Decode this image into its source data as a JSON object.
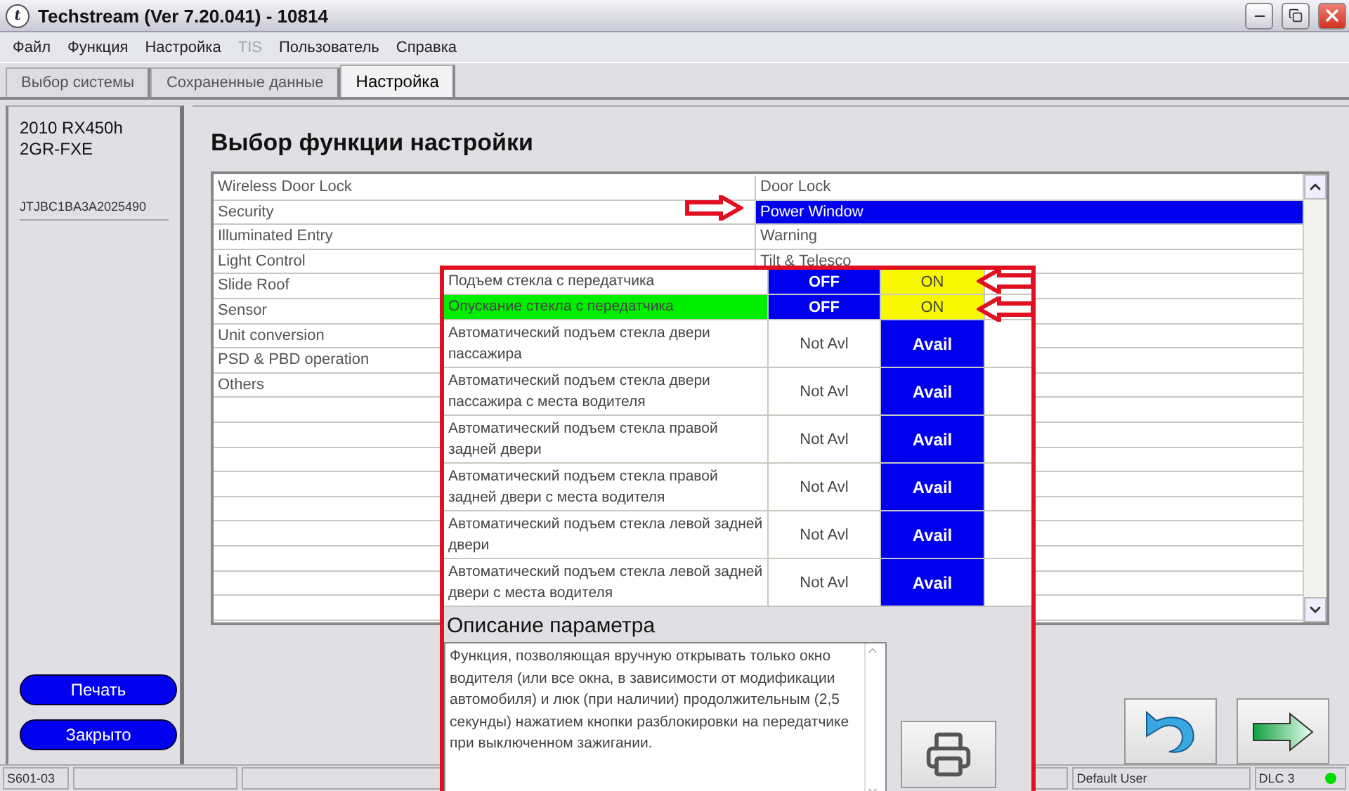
{
  "window": {
    "app_icon_letter": "t",
    "title": "Techstream (Ver 7.20.041) - 10814"
  },
  "menu": [
    {
      "label": "Файл",
      "disabled": false
    },
    {
      "label": "Функция",
      "disabled": false
    },
    {
      "label": "Настройка",
      "disabled": false
    },
    {
      "label": "TIS",
      "disabled": true
    },
    {
      "label": "Пользователь",
      "disabled": false
    },
    {
      "label": "Справка",
      "disabled": false
    }
  ],
  "tabs": [
    {
      "label": "Выбор системы",
      "selected": false
    },
    {
      "label": "Сохраненные данные",
      "selected": false
    },
    {
      "label": "Настройка",
      "selected": true
    }
  ],
  "vehicle": {
    "model": "2010 RX450h",
    "engine": "2GR-FXE",
    "vin": "JTJBC1BA3A2025490"
  },
  "sidebar_buttons": [
    "Печать",
    "Закрыто"
  ],
  "heading": "Выбор функции настройки",
  "systems": [
    "Wireless Door Lock",
    "Security",
    "Illuminated Entry",
    "Light Control",
    "Slide Roof",
    "Sensor",
    "Unit conversion",
    "PSD & PBD operation",
    "Others"
  ],
  "functions": [
    {
      "label": "Door Lock",
      "selected": false
    },
    {
      "label": "Power Window",
      "selected": true
    },
    {
      "label": "Warning",
      "selected": false
    },
    {
      "label": "Tilt & Telesco",
      "selected": false
    }
  ],
  "settings": [
    {
      "label": "Подъем стекла с передатчика",
      "highlighted": false,
      "options": [
        {
          "text": "OFF",
          "kind": "option"
        },
        {
          "text": "ON",
          "kind": "current"
        }
      ]
    },
    {
      "label": "Опускание стекла с передатчика",
      "highlighted": true,
      "options": [
        {
          "text": "OFF",
          "kind": "option"
        },
        {
          "text": "ON",
          "kind": "current"
        }
      ]
    },
    {
      "label": "Автоматический подъем стекла двери пассажира",
      "highlighted": false,
      "options": [
        {
          "text": "Not Avl",
          "kind": "plain"
        },
        {
          "text": "Avail",
          "kind": "option"
        }
      ]
    },
    {
      "label": "Автоматический подъем стекла двери пассажира с места водителя",
      "highlighted": false,
      "options": [
        {
          "text": "Not Avl",
          "kind": "plain"
        },
        {
          "text": "Avail",
          "kind": "option"
        }
      ]
    },
    {
      "label": "Автоматический подъем стекла правой задней двери",
      "highlighted": false,
      "options": [
        {
          "text": "Not Avl",
          "kind": "plain"
        },
        {
          "text": "Avail",
          "kind": "option"
        }
      ]
    },
    {
      "label": "Автоматический подъем стекла правой задней двери с места водителя",
      "highlighted": false,
      "options": [
        {
          "text": "Not Avl",
          "kind": "plain"
        },
        {
          "text": "Avail",
          "kind": "option"
        }
      ]
    },
    {
      "label": "Автоматический подъем стекла левой задней двери",
      "highlighted": false,
      "options": [
        {
          "text": "Not Avl",
          "kind": "plain"
        },
        {
          "text": "Avail",
          "kind": "option"
        }
      ]
    },
    {
      "label": "Автоматический подъем стекла левой задней двери с места водителя",
      "highlighted": false,
      "options": [
        {
          "text": "Not Avl",
          "kind": "plain"
        },
        {
          "text": "Avail",
          "kind": "option"
        }
      ]
    }
  ],
  "description": {
    "title": "Описание параметра",
    "text": "Функция, позволяющая вручную открывать только окно водителя (или все окна, в зависимости от модификации автомобиля) и люк (при наличии) продолжительным (2,5 секунды) нажатием кнопки разблокировки на передатчике при выключенном зажигании."
  },
  "status_bar": {
    "code": "S601-03",
    "user": "Default User",
    "connection": "DLC 3",
    "connected": true
  }
}
